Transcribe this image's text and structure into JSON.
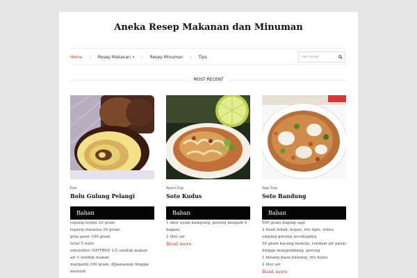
{
  "site": {
    "title": "Aneka Resep Makanan dan Minuman"
  },
  "nav": {
    "items": [
      {
        "label": "Home"
      },
      {
        "label": "Resep Makanan »"
      },
      {
        "label": "Resep Minuman"
      },
      {
        "label": "Tips"
      }
    ],
    "separator": "/"
  },
  "search": {
    "placeholder": "cari resep"
  },
  "section": {
    "label": "MOST RECENT"
  },
  "colors": {
    "accent": "#c0392b",
    "bahan_bar": "#050505",
    "background": "#e6e6e6"
  },
  "posts": [
    {
      "category": "Kue",
      "title": "Bolu Gulung Pelangi",
      "bahan_label": "Bahan",
      "ingredients": [
        "tepung terigu 20 gram",
        "tepung maizena 20 gram",
        "gula pasir 100 gram",
        "telur 5 butir",
        "emulsifier (SP/TBM) 1/2 sendok makan",
        "air 1 sendok makan",
        "margarin 100 gram, dipanaskan hingga",
        "meleleh"
      ]
    },
    {
      "category": "Ayam,Sup",
      "title": "Soto Kudus",
      "bahan_label": "Bahan",
      "ingredients": [
        "1 ekor ayam kampung, potong menjadi 4",
        "bagian",
        "2 liter air"
      ],
      "read_more": "Read more"
    },
    {
      "category": "Sapi,Sup",
      "title": "Soto Bandung",
      "bahan_label": "Bahan",
      "ingredients": [
        "500 gram daging sapi",
        "2 buah lobak, kupas, iris tipis, rebus",
        "emping goreng secukupnya",
        "50 gram kacang kedelai, rendam air panas",
        "hingga mengembang, goreng",
        "1 batang daun bawang, iris halus",
        "2 liter air"
      ],
      "read_more": "Read more"
    }
  ]
}
